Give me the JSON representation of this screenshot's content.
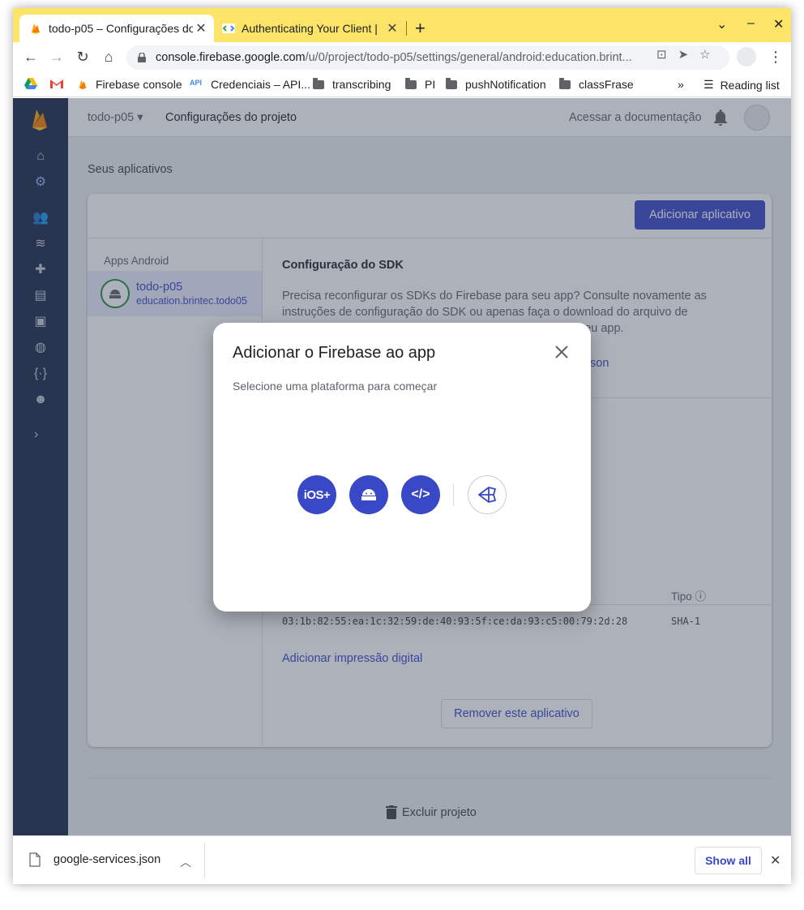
{
  "browser": {
    "tabs": [
      {
        "title": "todo-p05 – Configurações do",
        "favicon": "firebase-icon"
      },
      {
        "title": "Authenticating Your Client |",
        "favicon": "code-icon"
      }
    ],
    "url_host": "console.firebase.google.com",
    "url_path": "/u/0/project/todo-p05/settings/general/android:education.brint...",
    "bookmarks": [
      {
        "label": "",
        "icon": "drive-icon"
      },
      {
        "label": "",
        "icon": "gmail-icon"
      },
      {
        "label": "Firebase console",
        "icon": "firebase-icon"
      },
      {
        "label": "Credenciais – API...",
        "icon": "api-icon"
      },
      {
        "label": "transcribing",
        "icon": "folder-icon"
      },
      {
        "label": "PI",
        "icon": "folder-icon"
      },
      {
        "label": "pushNotification",
        "icon": "folder-icon"
      },
      {
        "label": "classFrase",
        "icon": "folder-icon"
      }
    ],
    "bookmarks_more": "»",
    "reading_list": "Reading list"
  },
  "firebase": {
    "project_name": "todo-p05",
    "breadcrumb": "Configurações do projeto",
    "docs_link": "Acessar a documentação",
    "section_title": "Seus aplicativos",
    "add_app_button": "Adicionar aplicativo",
    "apps_category": "Apps Android",
    "app": {
      "name": "todo-p05",
      "package": "education.brintec.todo05"
    },
    "sdk_title": "Configuração do SDK",
    "sdk_description": "Precisa reconfigurar os SDKs do Firebase para seu app? Consulte novamente as instruções de configuração do SDK ou apenas faça o download do arquivo de configuração que contém as chaves e identificadores do seu app.",
    "sdk_link_partial": "son",
    "tipo_header": "Tipo",
    "fingerprint_value": "03:1b:82:55:ea:1c:32:59:de:40:93:5f:ce:da:93:c5:00:79:2d:28",
    "fingerprint_type": "SHA-1",
    "add_fingerprint": "Adicionar impressão digital",
    "remove_app": "Remover este aplicativo",
    "delete_project": "Excluir projeto"
  },
  "dialog": {
    "title": "Adicionar o Firebase ao app",
    "subtitle": "Selecione uma plataforma para começar",
    "platforms": [
      {
        "name": "ios",
        "label": "iOS+"
      },
      {
        "name": "android",
        "label": ""
      },
      {
        "name": "web",
        "label": "</>"
      },
      {
        "name": "unity",
        "label": ""
      }
    ]
  },
  "downloads": {
    "file": "google-services.json",
    "show_all": "Show all"
  },
  "colors": {
    "accent": "#3848c7",
    "rail": "#1b2a4a",
    "tabstrip": "#fbe468"
  }
}
